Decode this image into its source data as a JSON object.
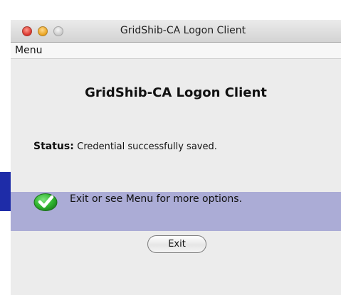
{
  "window": {
    "title": "GridShib-CA Logon Client"
  },
  "menubar": {
    "menu_label": "Menu"
  },
  "main": {
    "heading": "GridShib-CA Logon Client",
    "status_label": "Status:",
    "status_text": "Credential successfully saved.",
    "message": "Exit or see Menu for more options.",
    "exit_label": "Exit"
  },
  "icons": {
    "success": "check-circle-icon"
  },
  "colors": {
    "message_band": "#abacd6",
    "left_accent": "#1e2ca8",
    "success_green": "#2fb52f"
  }
}
